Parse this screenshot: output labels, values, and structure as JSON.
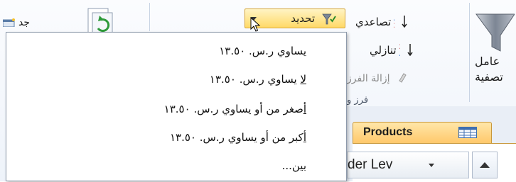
{
  "ribbon": {
    "new_label": "جد",
    "selection_label": "تحديد",
    "sort_ascending_label": "تصاعدي",
    "sort_descending_label": "تنازلي",
    "clear_sort_label": "إزالة الفرز",
    "group_label": "فرز و",
    "filter_label_line1": "عامل",
    "filter_label_line2": "تصفية"
  },
  "selection_menu": {
    "items": [
      {
        "accel": "ي",
        "rest": "ساوي ر.س. ١٣.٥٠"
      },
      {
        "accel": "لا",
        "rest": " يساوي ر.س. ١٣.٥٠"
      },
      {
        "accel": "أ",
        "rest": "صغر من أو يساوي ر.س. ١٣.٥٠"
      },
      {
        "accel": "أ",
        "rest": "كبر من أو يساوي ر.س. ١٣.٥٠"
      },
      {
        "accel": "ب",
        "rest": "ين..."
      }
    ]
  },
  "table": {
    "tab_name": "Products",
    "column_header": "der Lev"
  },
  "colors": {
    "highlight": "#ffd967",
    "tab": "#ffc86b",
    "ribbon_bg": "#eef3fa"
  },
  "icons": [
    "new-record-icon",
    "refresh-icon",
    "selection-filter-icon",
    "sort-ascending-icon",
    "sort-descending-icon",
    "clear-sort-icon",
    "filter-funnel-icon",
    "table-icon",
    "mouse-cursor-icon"
  ]
}
